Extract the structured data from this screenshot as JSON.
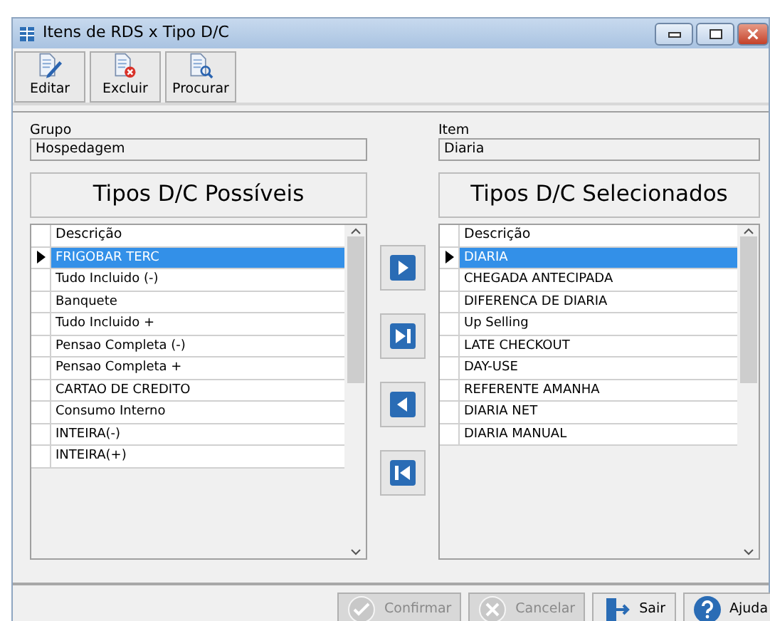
{
  "window": {
    "title": "Itens de RDS x Tipo D/C"
  },
  "toolbar": [
    {
      "label": "Editar",
      "kind": "edit"
    },
    {
      "label": "Excluir",
      "kind": "delete"
    },
    {
      "label": "Procurar",
      "kind": "find"
    }
  ],
  "grupo": {
    "label": "Grupo",
    "value": "Hospedagem"
  },
  "item": {
    "label": "Item",
    "value": "Diaria"
  },
  "available": {
    "heading": "Tipos D/C Possíveis",
    "column": "Descrição",
    "rows": [
      {
        "text": "FRIGOBAR TERC",
        "selected": true
      },
      {
        "text": "Tudo Incluido (-)",
        "selected": false
      },
      {
        "text": "Banquete",
        "selected": false
      },
      {
        "text": "Tudo Incluido +",
        "selected": false
      },
      {
        "text": "Pensao Completa (-)",
        "selected": false
      },
      {
        "text": "Pensao Completa +",
        "selected": false
      },
      {
        "text": "CARTAO DE CREDITO",
        "selected": false
      },
      {
        "text": "Consumo Interno",
        "selected": false
      },
      {
        "text": "INTEIRA(-)",
        "selected": false
      },
      {
        "text": "INTEIRA(+)",
        "selected": false
      }
    ]
  },
  "move_buttons": [
    {
      "kind": "add"
    },
    {
      "kind": "add_all"
    },
    {
      "kind": "remove"
    },
    {
      "kind": "remove_all"
    }
  ],
  "chosen": {
    "heading": "Tipos D/C Selecionados",
    "column": "Descrição",
    "rows": [
      {
        "text": "DIARIA",
        "selected": true
      },
      {
        "text": "CHEGADA ANTECIPADA",
        "selected": false
      },
      {
        "text": "DIFERENCA DE DIARIA",
        "selected": false
      },
      {
        "text": "Up Selling",
        "selected": false
      },
      {
        "text": "LATE CHECKOUT",
        "selected": false
      },
      {
        "text": "DAY-USE",
        "selected": false
      },
      {
        "text": "REFERENTE AMANHA",
        "selected": false
      },
      {
        "text": "DIARIA NET",
        "selected": false
      },
      {
        "text": "DIARIA MANUAL",
        "selected": false
      }
    ]
  },
  "footer": [
    {
      "label": "Confirmar",
      "kind": "confirm",
      "disabled": true
    },
    {
      "label": "Cancelar",
      "kind": "cancel",
      "disabled": true
    },
    {
      "label": "Sair",
      "kind": "exit",
      "disabled": false
    },
    {
      "label": "Ajuda",
      "kind": "help",
      "disabled": false
    }
  ]
}
